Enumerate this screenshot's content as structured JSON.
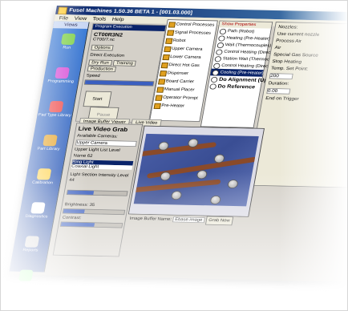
{
  "window": {
    "title": "Fusel Machines 1.50.36 BETA 1 - [001.03.000]"
  },
  "menu": [
    "File",
    "View",
    "Tools",
    "Help"
  ],
  "sidebar": {
    "header": "Views",
    "items": [
      {
        "label": "Run",
        "icon": "run-icon",
        "color": "#7fd04a"
      },
      {
        "label": "Programming",
        "icon": "programming-icon",
        "color": "#d64ad6"
      },
      {
        "label": "Pad Type Library",
        "icon": "pad-library-icon",
        "color": "#e44"
      },
      {
        "label": "Part Library",
        "icon": "part-library-icon",
        "color": "#e4a020"
      },
      {
        "label": "Calibration",
        "icon": "calibration-icon",
        "color": "#ffd040"
      },
      {
        "label": "Diagnostics",
        "icon": "diagnostics-icon",
        "color": "#fff"
      },
      {
        "label": "Reports",
        "icon": "reports-icon",
        "color": "#ccc"
      },
      {
        "label": "Configuration",
        "icon": "configuration-icon",
        "color": "#8f8"
      }
    ]
  },
  "run_panel": {
    "title": "Program Execution",
    "program_name": "CT00R3N2",
    "program_sub": "CT00/7.nc",
    "options_label": "Options",
    "direct_execution": "Direct Execution",
    "tabs": [
      "Dry Run",
      "Training",
      "Production"
    ],
    "speed_label": "Speed",
    "speed_percent": 100,
    "start_label": "Start",
    "pause_label": "Pause"
  },
  "tool_list": [
    "Control Processes",
    "Signal Processes",
    "Robot",
    "Upper Camera",
    "Lower Camera",
    "Direct Hot Gas",
    "Dispenser",
    "Board Carrier",
    "Manual Placer",
    "Operator Prompt",
    "Pre-Heater"
  ],
  "properties": {
    "header": "Show Properties",
    "items": [
      {
        "label": "Path (Robot)",
        "selected": false
      },
      {
        "label": "Heating (Pre-Heater)",
        "selected": false
      },
      {
        "label": "Wait (Thermocouples)",
        "selected": false
      },
      {
        "label": "Control Heating (Direct Hot Gas)",
        "selected": false
      },
      {
        "label": "Station Wait (Thermocouples)",
        "selected": false
      },
      {
        "label": "Control Heating (Direct Hot Gas)",
        "selected": false
      },
      {
        "label": "Cooling (Pre-Heater)",
        "selected": true
      },
      {
        "label": "Do Alignment (Upper Camera)",
        "selected": false
      },
      {
        "label": "Do Reference",
        "selected": false
      }
    ]
  },
  "right_panel": {
    "nozzles_label": "Nozzles:",
    "use_current_nozzle": "Use current nozzle",
    "process_air": "Process Air",
    "air_option": "Air",
    "special_gas": "Special Gas Source",
    "stop_heating": "Stop Heating",
    "temp_set_point": "Temp. Set Point:",
    "duration": "Duration:",
    "duration_value": "0.00",
    "temp_value": "200",
    "end_trigger": "End on Trigger"
  },
  "view_tabs": [
    "Image Buffer Viewer",
    "Live Video"
  ],
  "video_panel": {
    "title": "Live Video Grab",
    "available_cameras": "Available Cameras:",
    "upper_camera": "Upper Camera",
    "upper_light_list": "Upper Light List",
    "level_header": "Level",
    "light_level": "62",
    "name_header": "Name",
    "lights": [
      "Ring Light",
      "Coaxial Light"
    ],
    "light_section_label": "Light Section Intensity Level",
    "intensity_value": "44",
    "brightness_label": "Brightness:",
    "brightness_value": "35",
    "contrast_label": "Contrast:"
  },
  "image_buffer": {
    "name_label": "Image Buffer Name:",
    "name_value": "Ebase.image",
    "grab_button": "Grab Now"
  }
}
